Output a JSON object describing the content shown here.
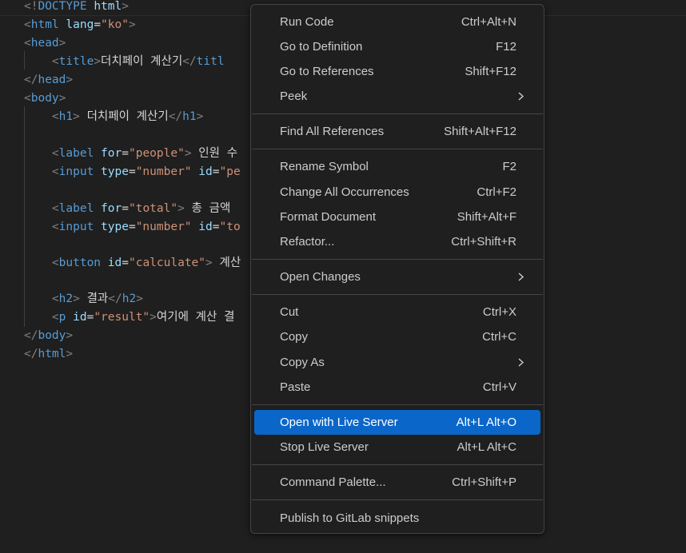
{
  "code": {
    "doctype": {
      "open": "<!",
      "keyword": "DOCTYPE",
      "space": " ",
      "name": "html",
      "close": ">"
    },
    "html_open": {
      "lt": "<",
      "tag": "html",
      "attr": "lang",
      "eq": "=",
      "val": "\"ko\"",
      "gt": ">"
    },
    "head_open": {
      "lt": "<",
      "tag": "head",
      "gt": ">"
    },
    "title_line": {
      "lt": "<",
      "tag": "title",
      "gt": ">",
      "text": "더치페이 계산기",
      "close_lt": "</",
      "close_tag": "titl"
    },
    "head_close": {
      "lt": "</",
      "tag": "head",
      "gt": ">"
    },
    "body_open": {
      "lt": "<",
      "tag": "body",
      "gt": ">"
    },
    "h1_line": {
      "lt": "<",
      "tag": "h1",
      "gt": ">",
      "text": " 더치페이 계산기",
      "close_lt": "</",
      "close_tag": "h1",
      "close_gt": ">"
    },
    "label_people": {
      "lt": "<",
      "tag": "label",
      "attr": "for",
      "eq": "=",
      "val": "\"people\"",
      "gt": ">",
      "text": " 인원 수"
    },
    "input_people": {
      "lt": "<",
      "tag": "input",
      "attr1": "type",
      "eq1": "=",
      "val1": "\"number\"",
      "attr2": "id",
      "eq2": "=",
      "val2": "\"pe"
    },
    "label_total": {
      "lt": "<",
      "tag": "label",
      "attr": "for",
      "eq": "=",
      "val": "\"total\"",
      "gt": ">",
      "text": " 총 금액"
    },
    "input_total": {
      "lt": "<",
      "tag": "input",
      "attr1": "type",
      "eq1": "=",
      "val1": "\"number\"",
      "attr2": "id",
      "eq2": "=",
      "val2": "\"to"
    },
    "button_line": {
      "lt": "<",
      "tag": "button",
      "attr": "id",
      "eq": "=",
      "val": "\"calculate\"",
      "gt": ">",
      "text": " 계산"
    },
    "h2_line": {
      "lt": "<",
      "tag": "h2",
      "gt": ">",
      "text": " 결과",
      "close_lt": "</",
      "close_tag": "h2",
      "close_gt": ">"
    },
    "p_line": {
      "lt": "<",
      "tag": "p",
      "attr": "id",
      "eq": "=",
      "val": "\"result\"",
      "gt": ">",
      "text": "여기에 계산 결"
    },
    "body_close": {
      "lt": "</",
      "tag": "body",
      "gt": ">"
    },
    "html_close": {
      "lt": "</",
      "tag": "html",
      "gt": ">"
    }
  },
  "context_menu": {
    "items": [
      {
        "label": "Run Code",
        "shortcut": "Ctrl+Alt+N"
      },
      {
        "label": "Go to Definition",
        "shortcut": "F12"
      },
      {
        "label": "Go to References",
        "shortcut": "Shift+F12"
      },
      {
        "label": "Peek",
        "shortcut": "",
        "submenu": true
      },
      {
        "label": "Find All References",
        "shortcut": "Shift+Alt+F12"
      },
      {
        "label": "Rename Symbol",
        "shortcut": "F2"
      },
      {
        "label": "Change All Occurrences",
        "shortcut": "Ctrl+F2"
      },
      {
        "label": "Format Document",
        "shortcut": "Shift+Alt+F"
      },
      {
        "label": "Refactor...",
        "shortcut": "Ctrl+Shift+R"
      },
      {
        "label": "Open Changes",
        "shortcut": "",
        "submenu": true
      },
      {
        "label": "Cut",
        "shortcut": "Ctrl+X"
      },
      {
        "label": "Copy",
        "shortcut": "Ctrl+C"
      },
      {
        "label": "Copy As",
        "shortcut": "",
        "submenu": true
      },
      {
        "label": "Paste",
        "shortcut": "Ctrl+V"
      },
      {
        "label": "Open with Live Server",
        "shortcut": "Alt+L Alt+O",
        "highlighted": true
      },
      {
        "label": "Stop Live Server",
        "shortcut": "Alt+L Alt+C"
      },
      {
        "label": "Command Palette...",
        "shortcut": "Ctrl+Shift+P"
      },
      {
        "label": "Publish to GitLab snippets",
        "shortcut": ""
      }
    ]
  },
  "colors": {
    "editor_bg": "#1f1f1f",
    "menu_bg": "#1f1f1f",
    "menu_border": "#454545",
    "highlight": "#0a66c9",
    "tag_name": "#569cd6",
    "attr_name": "#9cdcfe",
    "attr_value": "#ce9178",
    "bracket": "#808080",
    "text": "#d4d4d4"
  }
}
